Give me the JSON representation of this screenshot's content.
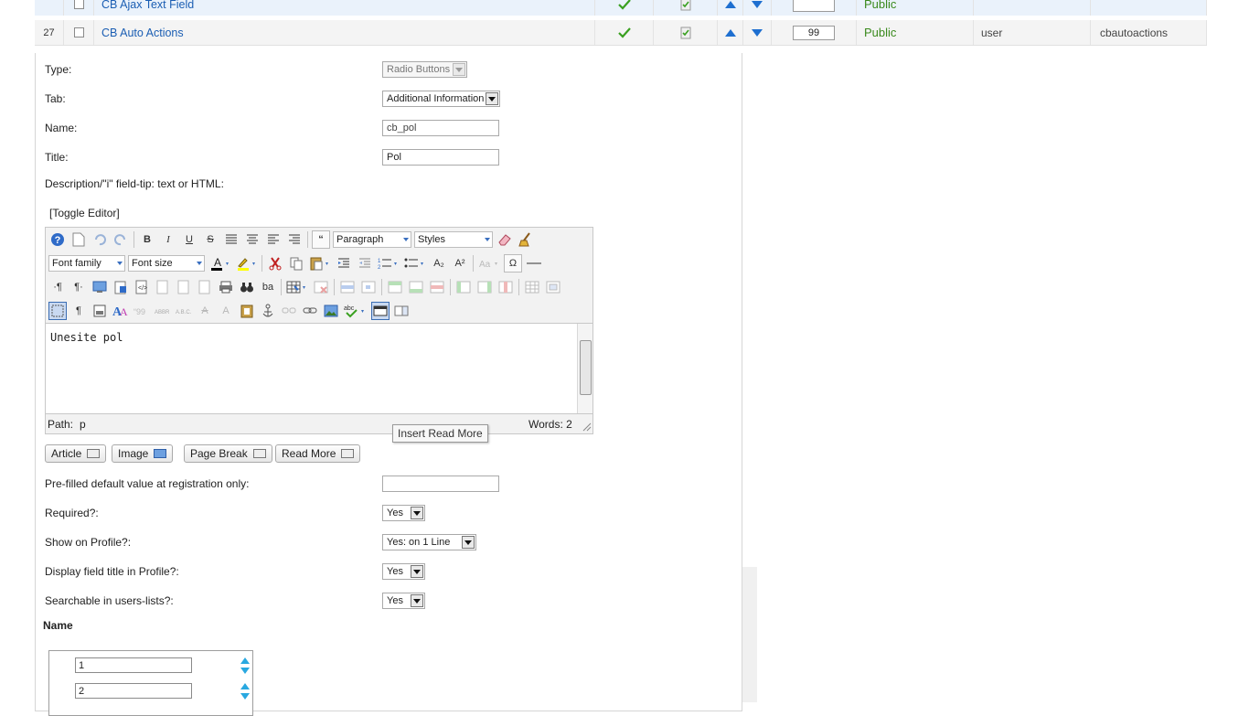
{
  "table": {
    "row_top": {
      "num": "",
      "name": "CB Ajax Text Field",
      "order": "",
      "access": "Public",
      "registration": "",
      "table_name": ""
    },
    "row_27": {
      "num": "27",
      "name": "CB Auto Actions",
      "order": "99",
      "access": "Public",
      "registration": "user",
      "table_name": "cbautoactions"
    }
  },
  "form": {
    "type_label": "Type:",
    "type_value": "Radio Buttons",
    "tab_label": "Tab:",
    "tab_value": "Additional Information",
    "name_label": "Name:",
    "name_value": "cb_pol",
    "title_label": "Title:",
    "title_value": "Pol",
    "description_label": "Description/\"i\" field-tip: text or HTML:",
    "toggle_editor": "[Toggle Editor]",
    "prefilled_label": "Pre-filled default value at registration only:",
    "prefilled_value": "",
    "required_label": "Required?:",
    "required_value": "Yes",
    "show_profile_label": "Show on Profile?:",
    "show_profile_value": "Yes: on 1 Line",
    "display_title_label": "Display field title in Profile?:",
    "display_title_value": "Yes",
    "searchable_label": "Searchable in users-lists?:",
    "searchable_value": "Yes"
  },
  "editor": {
    "format_value": "Paragraph",
    "styles_value": "Styles",
    "font_family": "Font family",
    "font_size": "Font size",
    "content": "Unesite pol",
    "path_label": "Path:",
    "path_value": "p",
    "words_label": "Words: 2",
    "tooltip": "Insert Read More",
    "glyphs": {
      "bold": "B",
      "italic": "I",
      "underline": "U",
      "strike": "S",
      "quote": "“",
      "omega": "Ω",
      "para": "¶",
      "para_ltr": "·¶",
      "para_rtl": "¶·",
      "sub": "A₂",
      "sup": "A²",
      "abc": "abc",
      "ba": "ba",
      "acronym_a": "A"
    }
  },
  "buttons": {
    "article": "Article",
    "image": "Image",
    "page_break": "Page Break",
    "read_more": "Read More"
  },
  "values_section": {
    "heading": "Name",
    "items": [
      "1",
      "2"
    ]
  },
  "colors": {
    "link": "#1b5eb3",
    "access_green": "#3a8a1d",
    "check_green": "#3aa020",
    "arrow_blue": "#1e6fd0"
  }
}
